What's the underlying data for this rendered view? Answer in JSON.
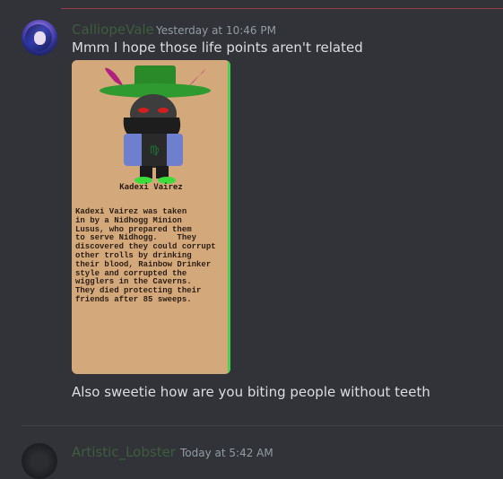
{
  "message1": {
    "username": "CalliopeVale",
    "timestamp": "Yesterday at 10:46 PM",
    "text1": "Mmm I hope those life points aren't related",
    "attachment": {
      "character_name": "Kadexi Vairez",
      "bio": "Kadexi Vairez was taken\nin by a Nidhogg Minion\nLusus, who prepared them\nto serve Nidhogg.    They\ndiscovered they could corrupt\nother trolls by drinking\ntheir blood, Rainbow Drinker\nstyle and corrupted the\nwigglers in the Caverns.\nThey died protecting their\nfriends after 85 sweeps."
    },
    "text2": "Also sweetie how are you biting people without teeth"
  },
  "message2": {
    "username": "Artistic_Lobster",
    "timestamp": "Today at 5:42 AM"
  },
  "colors": {
    "background": "#313338",
    "username": "#3e5c3e",
    "attachment_bg": "#d3a97c",
    "attachment_border": "#4bd24b"
  }
}
